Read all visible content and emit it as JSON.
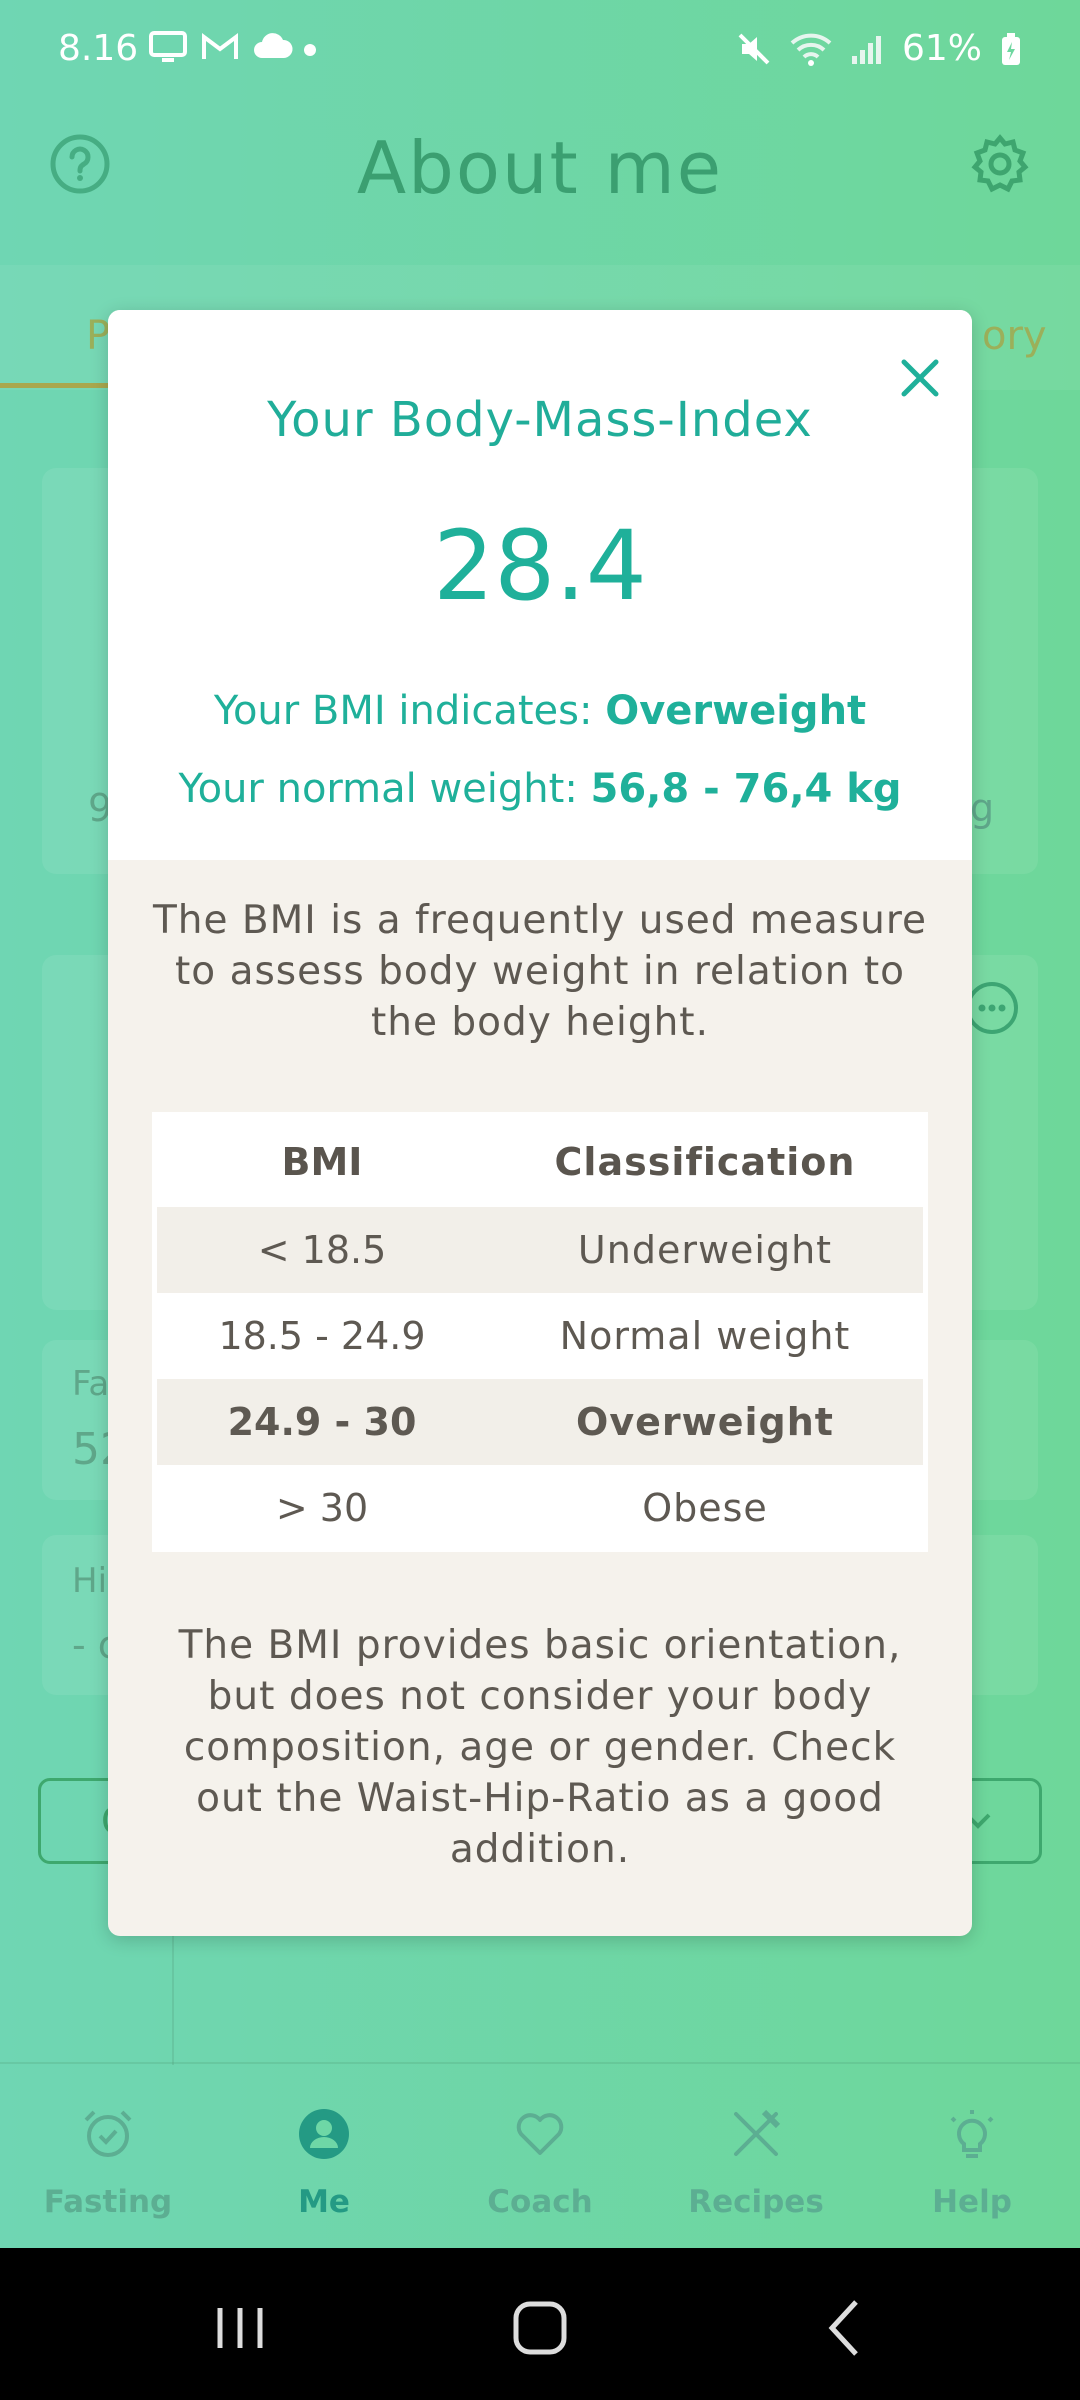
{
  "status_bar": {
    "time": "8.16",
    "battery": "61%"
  },
  "header": {
    "title": "About me"
  },
  "tabs": {
    "left_fragment": "P",
    "right_fragment": "ory"
  },
  "background_fragments": {
    "card1_left": "9",
    "card1_right": "g",
    "card3_label": "Fa",
    "card3_value": "52",
    "card4_label": "Hi",
    "card4_value": "- c",
    "btn_left": "C"
  },
  "bottom_nav": {
    "items": [
      {
        "label": "Fasting",
        "icon": "alarm-clock-icon"
      },
      {
        "label": "Me",
        "icon": "person-icon"
      },
      {
        "label": "Coach",
        "icon": "heart-icon"
      },
      {
        "label": "Recipes",
        "icon": "fork-knife-icon"
      },
      {
        "label": "Help",
        "icon": "lightbulb-icon"
      }
    ],
    "active": "Me"
  },
  "modal": {
    "title": "Your Body-Mass-Index",
    "bmi_value": "28.4",
    "indicates_prefix": "Your BMI indicates: ",
    "indicates_value": "Overweight",
    "normal_weight_prefix": "Your normal weight: ",
    "normal_weight_value": "56,8 - 76,4 kg",
    "intro": "The BMI is a frequently used measure to assess body weight in relation to the body height.",
    "table": {
      "headers": [
        "BMI",
        "Classification"
      ],
      "rows": [
        {
          "bmi": "< 18.5",
          "classification": "Underweight"
        },
        {
          "bmi": "18.5 - 24.9",
          "classification": "Normal weight"
        },
        {
          "bmi": "24.9 - 30",
          "classification": "Overweight"
        },
        {
          "bmi": "> 30",
          "classification": "Obese"
        }
      ]
    },
    "footer": "The BMI provides basic orientation, but does not consider your body composition, age or gender. Check out the Waist-Hip-Ratio as a good addition."
  },
  "colors": {
    "accent": "#1fb09a",
    "background_start": "#6fd6b3",
    "background_end": "#6ed79a"
  }
}
